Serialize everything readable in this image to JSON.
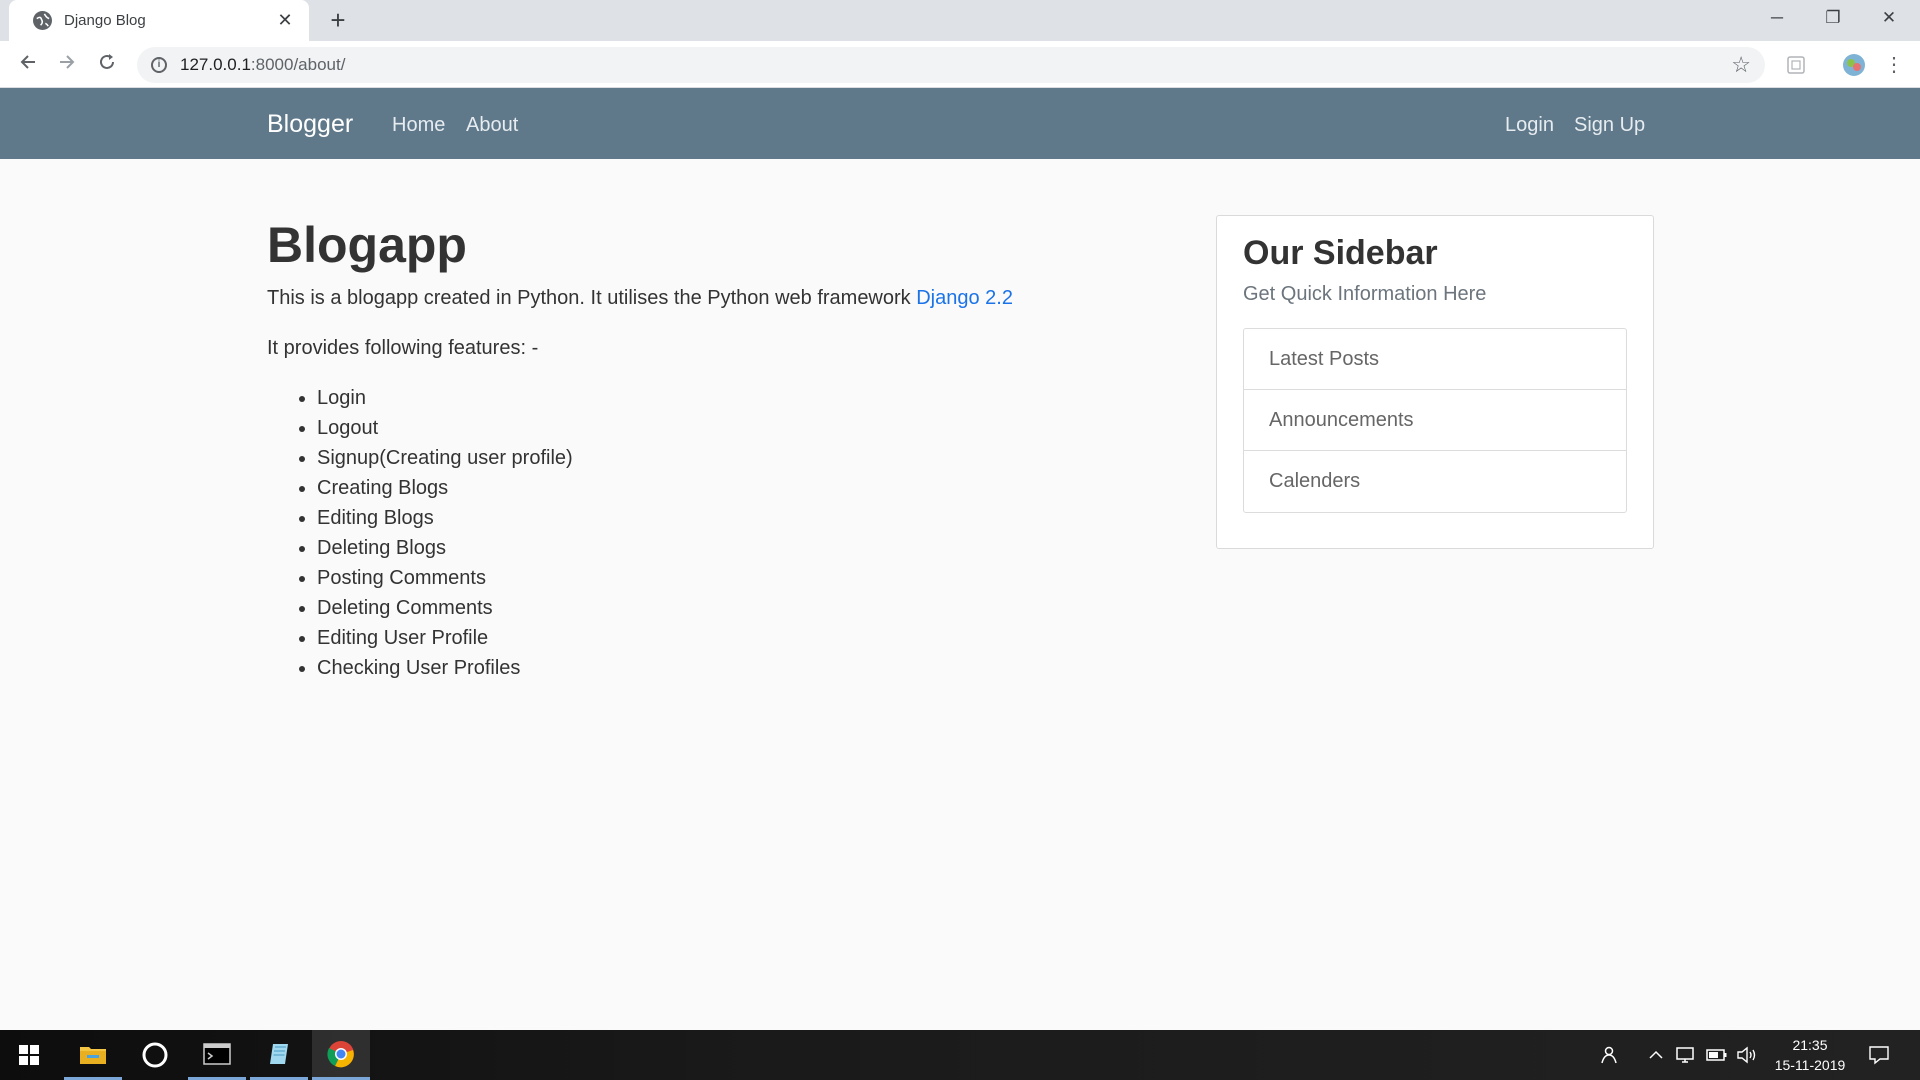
{
  "browser": {
    "tab_title": "Django Blog",
    "tab_close": "✕",
    "new_tab": "+",
    "url_host": "127.0.0.1",
    "url_path": ":8000/about/",
    "minimize": "─",
    "maximize": "❐",
    "close": "✕"
  },
  "navbar": {
    "brand": "Blogger",
    "home": "Home",
    "about": "About",
    "login": "Login",
    "signup": "Sign Up"
  },
  "main": {
    "heading": "Blogapp",
    "intro": "This is a blogapp created in Python. It utilises the Python web framework ",
    "intro_link": "Django 2.2",
    "features_intro": "It provides following features: -",
    "features": [
      "Login",
      "Logout",
      "Signup(Creating user profile)",
      "Creating Blogs",
      "Editing Blogs",
      "Deleting Blogs",
      "Posting Comments",
      "Deleting Comments",
      "Editing User Profile",
      "Checking User Profiles"
    ]
  },
  "sidebar": {
    "title": "Our Sidebar",
    "subtitle": "Get Quick Information Here",
    "items": [
      "Latest Posts",
      "Announcements",
      "Calenders"
    ]
  },
  "taskbar": {
    "time": "21:35",
    "date": "15-11-2019"
  },
  "icons": [
    "globe-icon",
    "back-arrow-icon",
    "forward-arrow-icon",
    "reload-icon",
    "info-icon",
    "star-icon",
    "windows-start-icon",
    "file-explorer-icon",
    "cortana-icon",
    "terminal-icon",
    "chrome-icon"
  ]
}
